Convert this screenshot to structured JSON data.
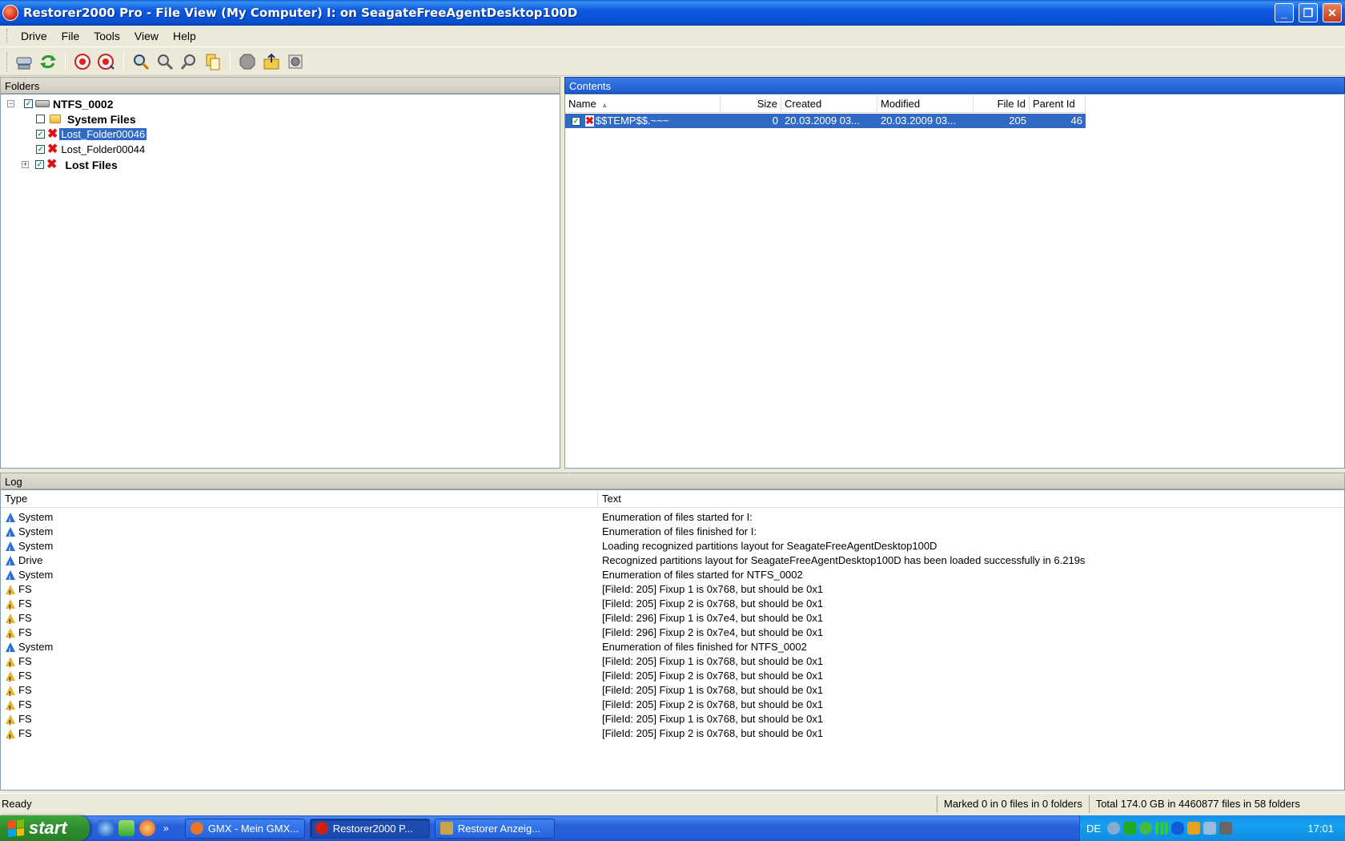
{
  "window": {
    "title": "Restorer2000 Pro - File View (My Computer) I: on SeagateFreeAgentDesktop100D",
    "min_glyph": "_",
    "max_glyph": "❐",
    "close_glyph": "✕"
  },
  "menu": [
    "Drive",
    "File",
    "Tools",
    "View",
    "Help"
  ],
  "toolbar_icons": [
    "drive-icon",
    "refresh-icon",
    "add-region-icon",
    "add-region-2-icon",
    "search-icon",
    "find-next-icon",
    "find-prev-icon",
    "copy-icon",
    "stop-icon",
    "export-icon",
    "settings-icon"
  ],
  "folders": {
    "title": "Folders",
    "tree": [
      {
        "label": "NTFS_0002",
        "level": 0,
        "expander": "−",
        "bold": true,
        "checked": true,
        "icon": "drive"
      },
      {
        "label": "System Files",
        "level": 1,
        "bold": true,
        "checked": false,
        "icon": "folder"
      },
      {
        "label": "Lost_Folder00046",
        "level": 1,
        "bold": false,
        "checked": true,
        "icon": "deleted",
        "selected": true
      },
      {
        "label": "Lost_Folder00044",
        "level": 1,
        "bold": false,
        "checked": true,
        "icon": "deleted"
      },
      {
        "label": "Lost Files",
        "level": 1,
        "expander": "+",
        "bold": true,
        "checked": true,
        "icon": "deleted"
      }
    ]
  },
  "contents": {
    "title": "Contents",
    "columns": [
      "Name",
      "Size",
      "Created",
      "Modified",
      "File Id",
      "Parent Id"
    ],
    "sort_indicator": "▲",
    "rows": [
      {
        "name": "$$TEMP$$.~~~",
        "size": "0",
        "created": "20.03.2009 03...",
        "modified": "20.03.2009 03...",
        "file_id": "205",
        "parent_id": "46"
      }
    ]
  },
  "log": {
    "title": "Log",
    "columns": [
      "Type",
      "Text"
    ],
    "rows": [
      {
        "type": "System",
        "level": "info",
        "text": "Enumeration of files started for I:"
      },
      {
        "type": "System",
        "level": "info",
        "text": "Enumeration of files finished for I:"
      },
      {
        "type": "System",
        "level": "info",
        "text": "Loading recognized partitions layout for SeagateFreeAgentDesktop100D"
      },
      {
        "type": "Drive",
        "level": "info",
        "text": "Recognized partitions layout for SeagateFreeAgentDesktop100D has been loaded successfully in 6.219s"
      },
      {
        "type": "System",
        "level": "info",
        "text": "Enumeration of files started for NTFS_0002"
      },
      {
        "type": "FS",
        "level": "warn",
        "text": "[FileId: 205] Fixup 1 is 0x768, but should be 0x1"
      },
      {
        "type": "FS",
        "level": "warn",
        "text": "[FileId: 205] Fixup 2 is 0x768, but should be 0x1"
      },
      {
        "type": "FS",
        "level": "warn",
        "text": "[FileId: 296] Fixup 1 is 0x7e4, but should be 0x1"
      },
      {
        "type": "FS",
        "level": "warn",
        "text": "[FileId: 296] Fixup 2 is 0x7e4, but should be 0x1"
      },
      {
        "type": "System",
        "level": "info",
        "text": "Enumeration of files finished for NTFS_0002"
      },
      {
        "type": "FS",
        "level": "warn",
        "text": "[FileId: 205] Fixup 1 is 0x768, but should be 0x1"
      },
      {
        "type": "FS",
        "level": "warn",
        "text": "[FileId: 205] Fixup 2 is 0x768, but should be 0x1"
      },
      {
        "type": "FS",
        "level": "warn",
        "text": "[FileId: 205] Fixup 1 is 0x768, but should be 0x1"
      },
      {
        "type": "FS",
        "level": "warn",
        "text": "[FileId: 205] Fixup 2 is 0x768, but should be 0x1"
      },
      {
        "type": "FS",
        "level": "warn",
        "text": "[FileId: 205] Fixup 1 is 0x768, but should be 0x1"
      },
      {
        "type": "FS",
        "level": "warn",
        "text": "[FileId: 205] Fixup 2 is 0x768, but should be 0x1"
      }
    ]
  },
  "status": {
    "ready": "Ready",
    "marked": "Marked 0 in 0 files in 0 folders",
    "total": "Total 174.0 GB in 4460877 files in 58 folders"
  },
  "taskbar": {
    "start_label": "start",
    "more_glyph": "»",
    "tasks": [
      {
        "label": "GMX - Mein GMX...",
        "active": false,
        "icon_color": "#e8742a"
      },
      {
        "label": "Restorer2000 P...",
        "active": true,
        "icon_color": "#d02010"
      },
      {
        "label": "Restorer Anzeig...",
        "active": false,
        "icon_color": "#c9a24a"
      }
    ],
    "language": "DE",
    "clock": "17:01"
  },
  "colors": {
    "selection": "#316ac5",
    "info": "#2a6fd8",
    "warn": "#e8b52a"
  }
}
